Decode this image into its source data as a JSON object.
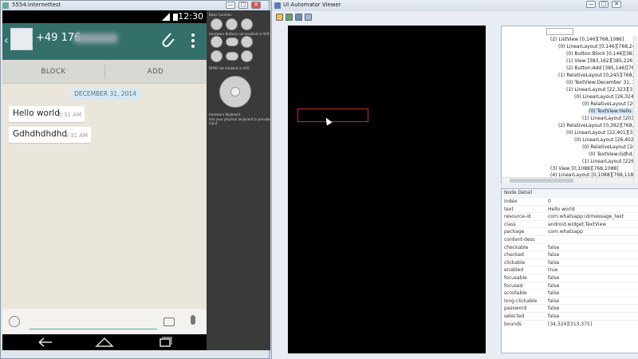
{
  "emulator": {
    "title": "5554:internettest",
    "controls": [
      "—",
      "□",
      "✕"
    ],
    "panel_label_1": "Basic Controls",
    "panel_label_2": "Hardware Buttons not enabled in AVD",
    "panel_label_3": "DPAD not enabled in AVD",
    "panel_label_4": "Hardware Keyboard",
    "panel_label_5": "Use your physical keyboard to provide input"
  },
  "phone": {
    "time": "12:30",
    "contact_number": "+49 176",
    "block_label": "BLOCK",
    "add_label": "ADD",
    "date_chip": "DECEMBER 31, 2014",
    "messages": [
      {
        "text": "Hello world",
        "time": "5:31 AM"
      },
      {
        "text": "Gdhdhdhdhd",
        "time": "5:31 AM"
      }
    ],
    "input_placeholder": ""
  },
  "uiav": {
    "title": "UI Automator Viewer",
    "tree": [
      "(2) ListView [0,146][768,1086]",
      "(0) LinearLayout [0,146][768,245]",
      "(0) Button:Block [0,146][383,...",
      "(1) View [383,162][385,226]",
      "(2) Button:Add [385,146][768...",
      "(1) RelativeLayout [0,245][768,39...",
      "(0) TextView:December 31, 20...",
      "(1) LinearLayout [22,323][313,...",
      "(0) LinearLayout [26,324]...",
      "(0) RelativeLayout [26...",
      "(0) TextView:Hello...",
      "(1) LinearLayout [203,...",
      "(2) RelativeLayout [0,392][768,47...",
      "(0) LinearLayout [22,401][336...",
      "(0) LinearLayout [26,402]...",
      "(0) RelativeLayout [26...",
      "(0) TextView:Gdhd...",
      "(1) LinearLayout [226,...",
      "(3) View [0,1088][768,1088]",
      "(4) LinearLayout [0,1088][768,1184]"
    ],
    "detail_header": "Node Detail",
    "details": [
      {
        "key": "index",
        "value": "0"
      },
      {
        "key": "text",
        "value": "Hello world"
      },
      {
        "key": "resource-id",
        "value": "com.whatsapp:id/message_text"
      },
      {
        "key": "class",
        "value": "android.widget.TextView"
      },
      {
        "key": "package",
        "value": "com.whatsapp"
      },
      {
        "key": "content-desc",
        "value": ""
      },
      {
        "key": "checkable",
        "value": "false"
      },
      {
        "key": "checked",
        "value": "false"
      },
      {
        "key": "clickable",
        "value": "false"
      },
      {
        "key": "enabled",
        "value": "true"
      },
      {
        "key": "focusable",
        "value": "false"
      },
      {
        "key": "focused",
        "value": "false"
      },
      {
        "key": "scrollable",
        "value": "false"
      },
      {
        "key": "long-clickable",
        "value": "false"
      },
      {
        "key": "password",
        "value": "false"
      },
      {
        "key": "selected",
        "value": "false"
      },
      {
        "key": "bounds",
        "value": "[34,324][313,375]"
      }
    ]
  },
  "colors": {
    "header_green": "#34706b",
    "chat_bg": "#ebe6dc",
    "highlight_red": "#c92a2a"
  }
}
